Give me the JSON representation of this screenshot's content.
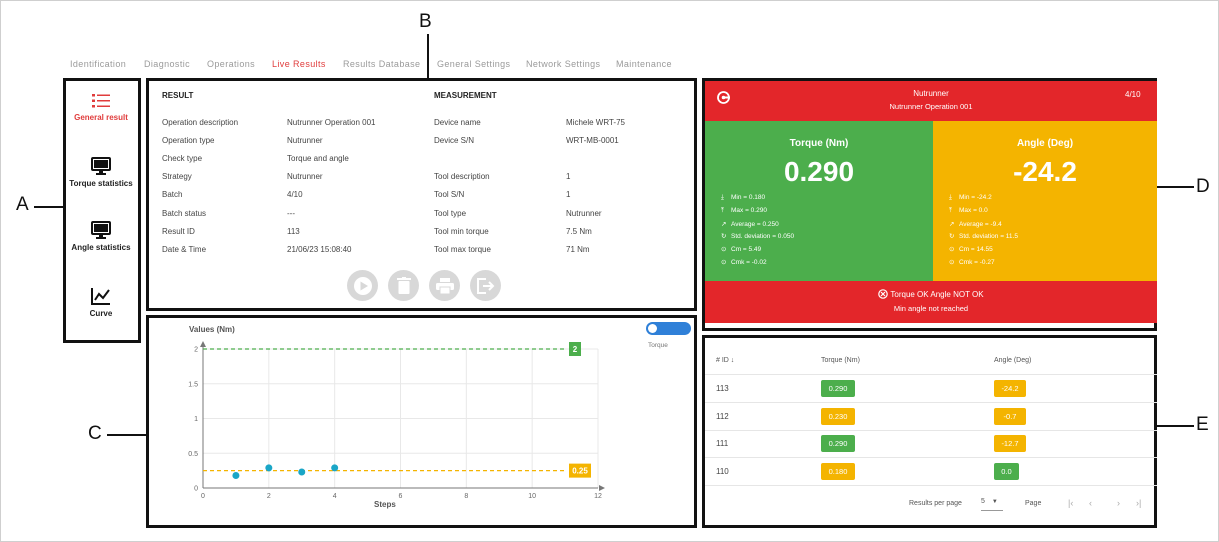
{
  "nav": {
    "tabs": [
      "Identification",
      "Diagnostic",
      "Operations",
      "Live Results",
      "Results Database",
      "General Settings",
      "Network Settings",
      "Maintenance"
    ],
    "active_index": 3
  },
  "callouts": {
    "a": "A",
    "b": "B",
    "c": "C",
    "d": "D",
    "e": "E"
  },
  "sidebar": {
    "items": [
      {
        "label": "General result",
        "icon": "list-icon",
        "active": true
      },
      {
        "label": "Torque statistics",
        "icon": "monitor-icon",
        "active": false
      },
      {
        "label": "Angle statistics",
        "icon": "monitor-icon",
        "active": false
      },
      {
        "label": "Curve",
        "icon": "line-chart-icon",
        "active": false
      }
    ]
  },
  "result": {
    "heading": "RESULT",
    "rows": [
      {
        "label": "Operation description",
        "value": "Nutrunner Operation 001"
      },
      {
        "label": "Operation type",
        "value": "Nutrunner"
      },
      {
        "label": "Check type",
        "value": "Torque and angle"
      },
      {
        "label": "Strategy",
        "value": "Nutrunner"
      },
      {
        "label": "Batch",
        "value": "4/10"
      },
      {
        "label": "Batch status",
        "value": "---"
      },
      {
        "label": "Result ID",
        "value": "113"
      },
      {
        "label": "Date & Time",
        "value": "21/06/23 15:08:40"
      }
    ]
  },
  "measurement": {
    "heading": "MEASUREMENT",
    "rows": [
      {
        "label": "Device name",
        "value": "Michele WRT-75"
      },
      {
        "label": "Device S/N",
        "value": "WRT-MB-0001"
      },
      {
        "label": "",
        "value": ""
      },
      {
        "label": "Tool description",
        "value": "1"
      },
      {
        "label": "Tool S/N",
        "value": "1"
      },
      {
        "label": "Tool type",
        "value": "Nutrunner"
      },
      {
        "label": "Tool min torque",
        "value": "7.5 Nm"
      },
      {
        "label": "Tool max torque",
        "value": "71 Nm"
      }
    ]
  },
  "actions": [
    "play-icon",
    "trash-icon",
    "print-icon",
    "export-icon"
  ],
  "live": {
    "title": "Nutrunner",
    "subtitle": "Nutrunner Operation 001",
    "counter": "4/10",
    "torque": {
      "title": "Torque (Nm)",
      "value": "0.290",
      "stats": [
        "Min = 0.180",
        "Max = 0.290",
        "Average = 0.250",
        "Std. deviation = 0.050",
        "Cm = 5.49",
        "Cmk = -0.02"
      ]
    },
    "angle": {
      "title": "Angle (Deg)",
      "value": "-24.2",
      "stats": [
        "Min = -24.2",
        "Max = 0.0",
        "Average = -9.4",
        "Std. deviation = 11.5",
        "Cm = 14.55",
        "Cmk = -0.27"
      ]
    },
    "status_line1": "Torque OK Angle NOT OK",
    "status_line2": "Min angle not reached",
    "colors": {
      "ok": "#4cae4c",
      "nok": "#e3262a",
      "warn": "#f4b400"
    }
  },
  "table": {
    "headers": [
      "# ID",
      "Torque (Nm)",
      "Angle (Deg)"
    ],
    "rows": [
      {
        "id": "113",
        "torque": "0.290",
        "torque_status": "ok",
        "angle": "-24.2",
        "angle_status": "warn"
      },
      {
        "id": "112",
        "torque": "0.230",
        "torque_status": "warn",
        "angle": "-0.7",
        "angle_status": "warn"
      },
      {
        "id": "111",
        "torque": "0.290",
        "torque_status": "ok",
        "angle": "-12.7",
        "angle_status": "warn"
      },
      {
        "id": "110",
        "torque": "0.180",
        "torque_status": "warn",
        "angle": "0.0",
        "angle_status": "ok"
      }
    ],
    "pagination": {
      "results_per_page_label": "Results per page",
      "results_per_page": "5",
      "page_label": "Page"
    }
  },
  "chart_data": {
    "type": "scatter",
    "title": "Values (Nm)",
    "xlabel": "Steps",
    "ylabel": "",
    "xlim": [
      0,
      12
    ],
    "ylim": [
      0,
      2
    ],
    "xticks": [
      0,
      2,
      4,
      6,
      8,
      10,
      12
    ],
    "yticks": [
      0,
      0.5,
      1,
      1.5,
      2
    ],
    "grid": true,
    "points": [
      {
        "x": 1,
        "y": 0.18
      },
      {
        "x": 2,
        "y": 0.29
      },
      {
        "x": 3,
        "y": 0.23
      },
      {
        "x": 4,
        "y": 0.29
      }
    ],
    "upper_limit": {
      "value": 2,
      "label": "2",
      "color": "#4cae4c"
    },
    "lower_limit": {
      "value": 0.25,
      "label": "0.25",
      "color": "#f4b400"
    },
    "toggle_label": "Torque",
    "point_color": "#1aa6c7"
  }
}
